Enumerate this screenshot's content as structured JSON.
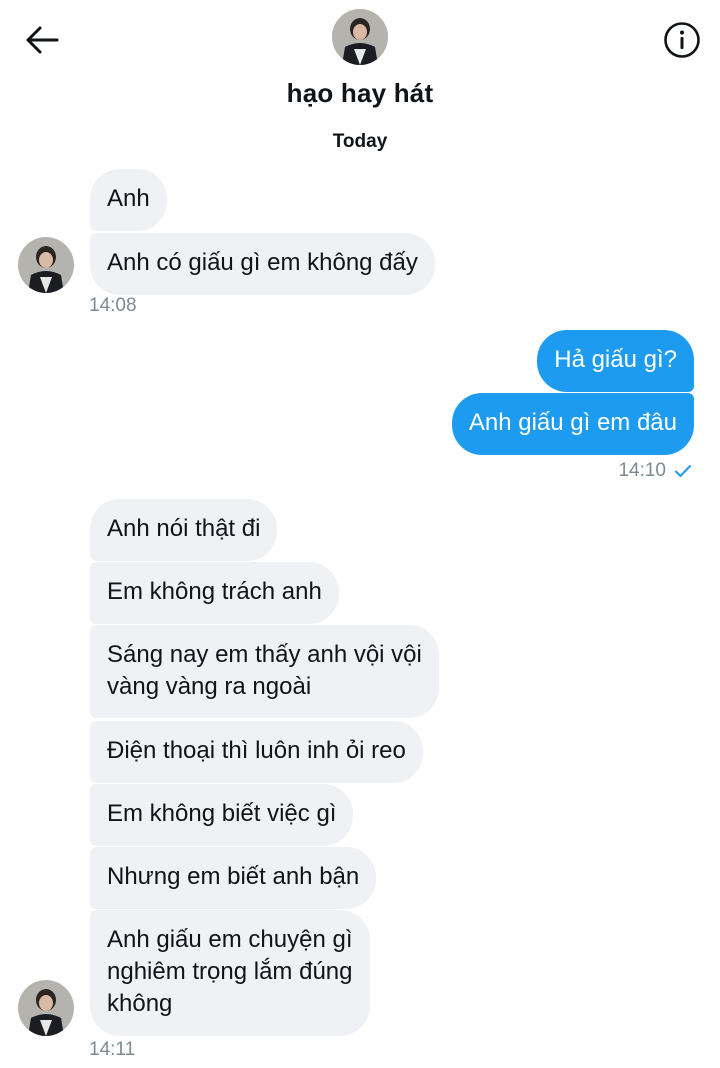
{
  "header": {
    "contact_name": "hạo hay hát",
    "day_label": "Today",
    "back_icon": "arrow-left-icon",
    "info_icon": "info-circle-icon"
  },
  "colors": {
    "incoming_bubble": "#eff1f4",
    "outgoing_bubble": "#1d9bf0",
    "timestamp": "#7d8a94",
    "check": "#1d9bf0"
  },
  "messages": {
    "m1": "Anh",
    "m2": "Anh có giấu gì em không đấy",
    "t1": "14:08",
    "m3": "Hả giấu gì?",
    "m4": "Anh giấu gì em đâu",
    "t2": "14:10",
    "m5": "Anh nói thật đi",
    "m6": "Em không trách anh",
    "m7": "Sáng nay em thấy anh vội vội\nvàng vàng ra ngoài",
    "m8": "Điện thoại thì luôn inh ỏi reo",
    "m9": "Em không biết việc gì",
    "m10": "Nhưng em biết anh bận",
    "m11": "Anh giấu em chuyện gì\nnghiêm trọng lắm đúng\nkhông",
    "t3": "14:11"
  }
}
